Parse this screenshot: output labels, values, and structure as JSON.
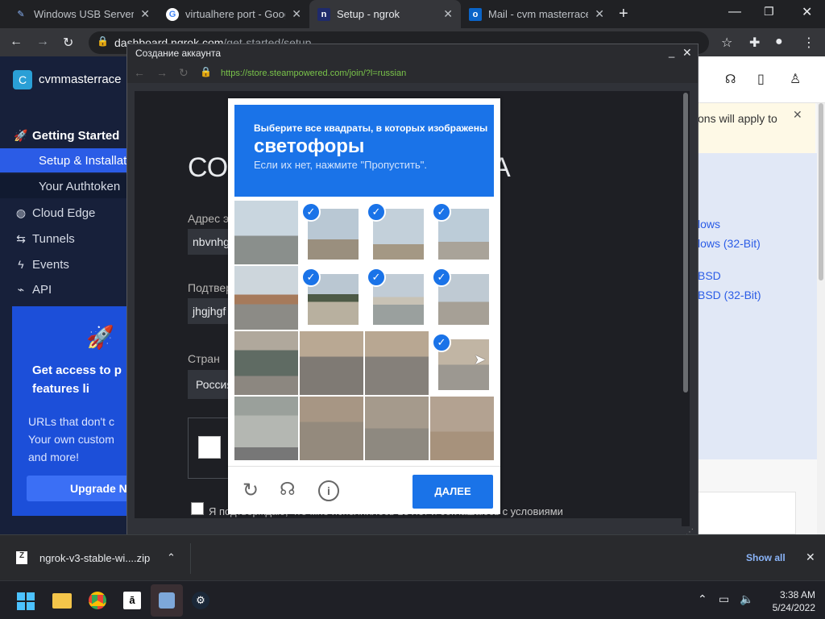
{
  "tabs": [
    {
      "title": "Windows USB Server |",
      "favicon": "usb-icon",
      "active": false
    },
    {
      "title": "virtualhere port - Goog",
      "favicon": "google-icon",
      "active": false
    },
    {
      "title": "Setup - ngrok",
      "favicon": "ngrok-icon",
      "active": true
    },
    {
      "title": "Mail - cvm masterrace",
      "favicon": "outlook-icon",
      "active": false
    }
  ],
  "omnibox": {
    "url": "dashboard.ngrok.com",
    "path": "/get-started/setup"
  },
  "sidebar": {
    "account": "cvmmasterrace",
    "avatar_letter": "C",
    "items": [
      {
        "label": "Getting Started",
        "icon": "rocket-icon"
      },
      {
        "label": "Setup & Installat",
        "icon": ""
      },
      {
        "label": "Your Authtoken",
        "icon": ""
      },
      {
        "label": "Cloud Edge",
        "icon": "globe-icon"
      },
      {
        "label": "Tunnels",
        "icon": "tunnels-icon"
      },
      {
        "label": "Events",
        "icon": "bolt-icon"
      },
      {
        "label": "API",
        "icon": "api-icon"
      }
    ]
  },
  "promo": {
    "title": "Get access to p features li",
    "bullets": [
      "URLs that don't c",
      "Your own custom",
      "and more!"
    ],
    "button": "Upgrade N"
  },
  "right": {
    "banner": "ons will apply to",
    "links": [
      "lows",
      "lows (32-Bit)",
      "BSD",
      "BSD (32-Bit)"
    ]
  },
  "popup": {
    "title": "Создание аккаунта",
    "url": "https://store.steampowered.com/join/?l=russian"
  },
  "steam": {
    "heading": "СО",
    "heading_tail": "А",
    "email_label": "Адрес э",
    "email_value": "nbvnhg",
    "confirm_label": "Подтвер",
    "confirm_value": "jhgjhgf",
    "country_label": "Стран",
    "country_value": "Россия",
    "agree_text": "Я подтверждаю, что мне исполнилось 13 лет и соглашаюсь с условиями"
  },
  "captcha": {
    "instruction": "Выберите все квадраты, в которых изображены",
    "target": "светофоры",
    "hint": "Если их нет, нажмите \"Пропустить\".",
    "button": "ДАЛЕЕ",
    "selected": [
      1,
      2,
      3,
      5,
      6,
      7,
      11
    ]
  },
  "downloads": {
    "file": "ngrok-v3-stable-wi....zip",
    "show_all": "Show all"
  },
  "taskbar": {
    "time": "3:38 AM",
    "date": "5/24/2022"
  }
}
